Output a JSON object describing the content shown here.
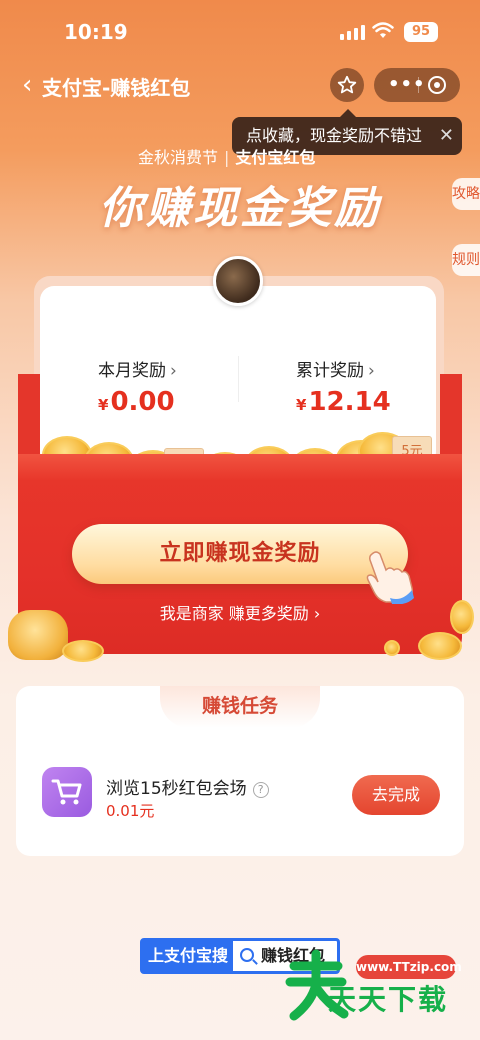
{
  "status_bar": {
    "time": "10:19",
    "battery": "95"
  },
  "nav": {
    "title": "支付宝-赚钱红包"
  },
  "tooltip": {
    "text": "点收藏，现金奖励不错过"
  },
  "banner": {
    "festival": "金秋消费节",
    "partner": "支付宝红包",
    "headline": "你赚现金奖励"
  },
  "side_tabs": [
    "攻略",
    "规则"
  ],
  "rewards": {
    "month_label": "本月奖励",
    "month_value": "0.00",
    "total_label": "累计奖励",
    "total_value": "12.14",
    "currency": "¥",
    "chevron": "›"
  },
  "coin_bills": [
    "2元",
    "5元"
  ],
  "cta": {
    "label": "立即赚现金奖励",
    "merchant_link": "我是商家 赚更多奖励 ›"
  },
  "tasks": {
    "header": "赚钱任务",
    "items": [
      {
        "title": "浏览15秒红包会场",
        "reward": "0.01元",
        "button": "去完成",
        "help": "?"
      }
    ]
  },
  "search_banner": {
    "prefix": "上支付宝搜",
    "query": "赚钱红包"
  },
  "watermark": {
    "url": "www.TTzip.com",
    "text": "天天下载"
  },
  "colors": {
    "accent_red": "#e5301f",
    "brand_orange": "#f08a4b",
    "task_purple": "#9a5be0",
    "search_blue": "#2d6ff0"
  }
}
